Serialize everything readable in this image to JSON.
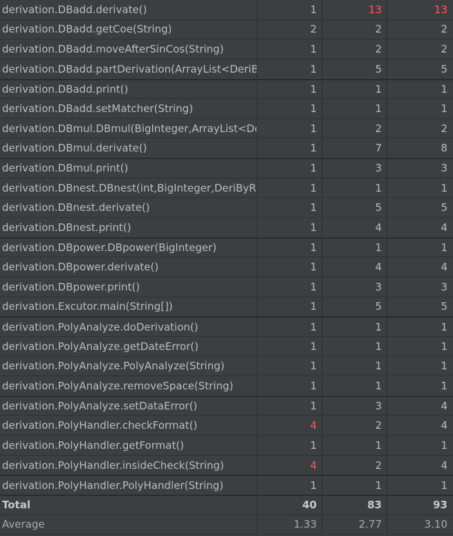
{
  "table": {
    "rows": [
      {
        "method": "derivation.DBadd.derivate()",
        "ev": "1",
        "iv": "13",
        "v": "13",
        "ev_red": false,
        "iv_red": true,
        "v_red": true,
        "group_start": false
      },
      {
        "method": "derivation.DBadd.getCoe(String)",
        "ev": "2",
        "iv": "2",
        "v": "2",
        "ev_red": false,
        "iv_red": false,
        "v_red": false,
        "group_start": false
      },
      {
        "method": "derivation.DBadd.moveAfterSinCos(String)",
        "ev": "1",
        "iv": "2",
        "v": "2",
        "ev_red": false,
        "iv_red": false,
        "v_red": false,
        "group_start": false
      },
      {
        "method": "derivation.DBadd.partDerivation(ArrayList<DeriByR",
        "ev": "1",
        "iv": "5",
        "v": "5",
        "ev_red": false,
        "iv_red": false,
        "v_red": false,
        "group_start": false
      },
      {
        "method": "derivation.DBadd.print()",
        "ev": "1",
        "iv": "1",
        "v": "1",
        "ev_red": false,
        "iv_red": false,
        "v_red": false,
        "group_start": true
      },
      {
        "method": "derivation.DBadd.setMatcher(String)",
        "ev": "1",
        "iv": "1",
        "v": "1",
        "ev_red": false,
        "iv_red": false,
        "v_red": false,
        "group_start": false
      },
      {
        "method": "derivation.DBmul.DBmul(BigInteger,ArrayList<Deri",
        "ev": "1",
        "iv": "2",
        "v": "2",
        "ev_red": false,
        "iv_red": false,
        "v_red": false,
        "group_start": false
      },
      {
        "method": "derivation.DBmul.derivate()",
        "ev": "1",
        "iv": "7",
        "v": "8",
        "ev_red": false,
        "iv_red": false,
        "v_red": false,
        "group_start": false
      },
      {
        "method": "derivation.DBmul.print()",
        "ev": "1",
        "iv": "3",
        "v": "3",
        "ev_red": false,
        "iv_red": false,
        "v_red": false,
        "group_start": true
      },
      {
        "method": "derivation.DBnest.DBnest(int,BigInteger,DeriByRule",
        "ev": "1",
        "iv": "1",
        "v": "1",
        "ev_red": false,
        "iv_red": false,
        "v_red": false,
        "group_start": false
      },
      {
        "method": "derivation.DBnest.derivate()",
        "ev": "1",
        "iv": "5",
        "v": "5",
        "ev_red": false,
        "iv_red": false,
        "v_red": false,
        "group_start": false
      },
      {
        "method": "derivation.DBnest.print()",
        "ev": "1",
        "iv": "4",
        "v": "4",
        "ev_red": false,
        "iv_red": false,
        "v_red": false,
        "group_start": false
      },
      {
        "method": "derivation.DBpower.DBpower(BigInteger)",
        "ev": "1",
        "iv": "1",
        "v": "1",
        "ev_red": false,
        "iv_red": false,
        "v_red": false,
        "group_start": true
      },
      {
        "method": "derivation.DBpower.derivate()",
        "ev": "1",
        "iv": "4",
        "v": "4",
        "ev_red": false,
        "iv_red": false,
        "v_red": false,
        "group_start": false
      },
      {
        "method": "derivation.DBpower.print()",
        "ev": "1",
        "iv": "3",
        "v": "3",
        "ev_red": false,
        "iv_red": false,
        "v_red": false,
        "group_start": false
      },
      {
        "method": "derivation.Excutor.main(String[])",
        "ev": "1",
        "iv": "5",
        "v": "5",
        "ev_red": false,
        "iv_red": false,
        "v_red": false,
        "group_start": false
      },
      {
        "method": "derivation.PolyAnalyze.doDerivation()",
        "ev": "1",
        "iv": "1",
        "v": "1",
        "ev_red": false,
        "iv_red": false,
        "v_red": false,
        "group_start": true
      },
      {
        "method": "derivation.PolyAnalyze.getDateError()",
        "ev": "1",
        "iv": "1",
        "v": "1",
        "ev_red": false,
        "iv_red": false,
        "v_red": false,
        "group_start": false
      },
      {
        "method": "derivation.PolyAnalyze.PolyAnalyze(String)",
        "ev": "1",
        "iv": "1",
        "v": "1",
        "ev_red": false,
        "iv_red": false,
        "v_red": false,
        "group_start": false
      },
      {
        "method": "derivation.PolyAnalyze.removeSpace(String)",
        "ev": "1",
        "iv": "1",
        "v": "1",
        "ev_red": false,
        "iv_red": false,
        "v_red": false,
        "group_start": false
      },
      {
        "method": "derivation.PolyAnalyze.setDataError()",
        "ev": "1",
        "iv": "3",
        "v": "4",
        "ev_red": false,
        "iv_red": false,
        "v_red": false,
        "group_start": true
      },
      {
        "method": "derivation.PolyHandler.checkFormat()",
        "ev": "4",
        "iv": "2",
        "v": "4",
        "ev_red": true,
        "iv_red": false,
        "v_red": false,
        "group_start": false
      },
      {
        "method": "derivation.PolyHandler.getFormat()",
        "ev": "1",
        "iv": "1",
        "v": "1",
        "ev_red": false,
        "iv_red": false,
        "v_red": false,
        "group_start": false
      },
      {
        "method": "derivation.PolyHandler.insideCheck(String)",
        "ev": "4",
        "iv": "2",
        "v": "4",
        "ev_red": true,
        "iv_red": false,
        "v_red": false,
        "group_start": false
      },
      {
        "method": "derivation.PolyHandler.PolyHandler(String)",
        "ev": "1",
        "iv": "1",
        "v": "1",
        "ev_red": false,
        "iv_red": false,
        "v_red": false,
        "group_start": true
      }
    ],
    "total": {
      "label": "Total",
      "ev": "40",
      "iv": "83",
      "v": "93"
    },
    "average": {
      "label": "Average",
      "ev": "1.33",
      "iv": "2.77",
      "v": "3.10"
    }
  },
  "colors": {
    "background": "#3c3f41",
    "text": "#bbbbbb",
    "warning": "#ff5a5a"
  }
}
